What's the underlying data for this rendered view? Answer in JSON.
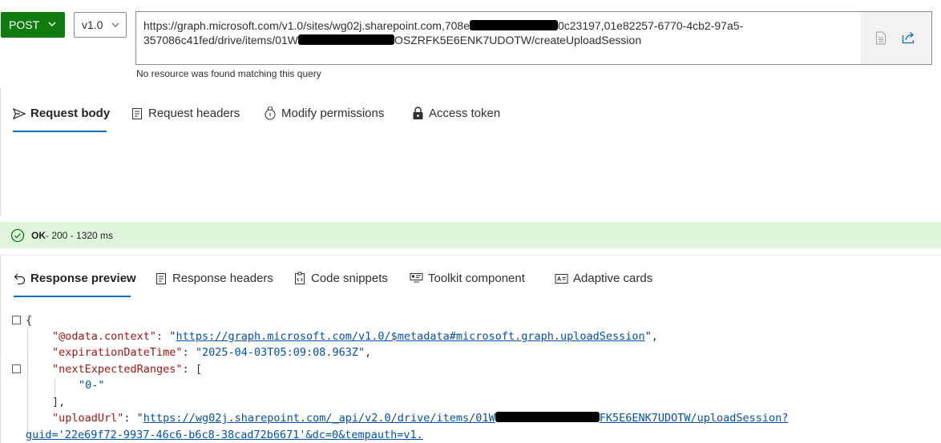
{
  "request": {
    "method": "POST",
    "version": "v1.0",
    "url_line1_a": "https://graph.microsoft.com/v1.0/sites/wg02j.sharepoint.com,708e",
    "url_line1_b": "0c23197,01e82257-6770-4cb2-97a5-",
    "url_line2_a": "357086c41fed/drive/items/01W",
    "url_line2_b": "OSZRFK5E6ENK7UDOTW/createUploadSession",
    "hint": "No resource was found matching this query"
  },
  "request_tabs": [
    {
      "label": "Request body",
      "icon": "send-icon",
      "active": true
    },
    {
      "label": "Request headers",
      "icon": "headers-icon",
      "active": false
    },
    {
      "label": "Modify permissions",
      "icon": "permissions-icon",
      "active": false
    },
    {
      "label": "Access token",
      "icon": "lock-icon",
      "active": false
    }
  ],
  "status": {
    "code_text": "OK",
    "detail": " - 200 - 1320 ms",
    "color": "#dff6dd"
  },
  "response_tabs": [
    {
      "label": "Response preview",
      "icon": "undo-icon",
      "active": true
    },
    {
      "label": "Response headers",
      "icon": "headers-icon",
      "active": false
    },
    {
      "label": "Code snippets",
      "icon": "code-snippet-icon",
      "active": false
    },
    {
      "label": "Toolkit component",
      "icon": "toolkit-icon",
      "active": false
    },
    {
      "label": "Adaptive cards",
      "icon": "card-icon",
      "active": false
    }
  ],
  "response": {
    "open_brace": "{",
    "k_context": "\"@odata.context\"",
    "v_context": "https://graph.microsoft.com/v1.0/$metadata#microsoft.graph.uploadSession",
    "k_expiration": "\"expirationDateTime\"",
    "v_expiration": "\"2025-04-03T05:09:08.963Z\"",
    "k_ranges": "\"nextExpectedRanges\"",
    "v_range0": "\"0-\"",
    "close_array": "],",
    "k_upload": "\"uploadUrl\"",
    "v_upload_a": "https://wg02j.sharepoint.com/_api/v2.0/drive/items/01W",
    "v_upload_b": "FK5E6ENK7UDOTW/uploadSession?",
    "v_upload_c": "guid='22e69f72-9937-46c6-b6c8-38cad72b6671'&dc=0&tempauth=v1."
  }
}
